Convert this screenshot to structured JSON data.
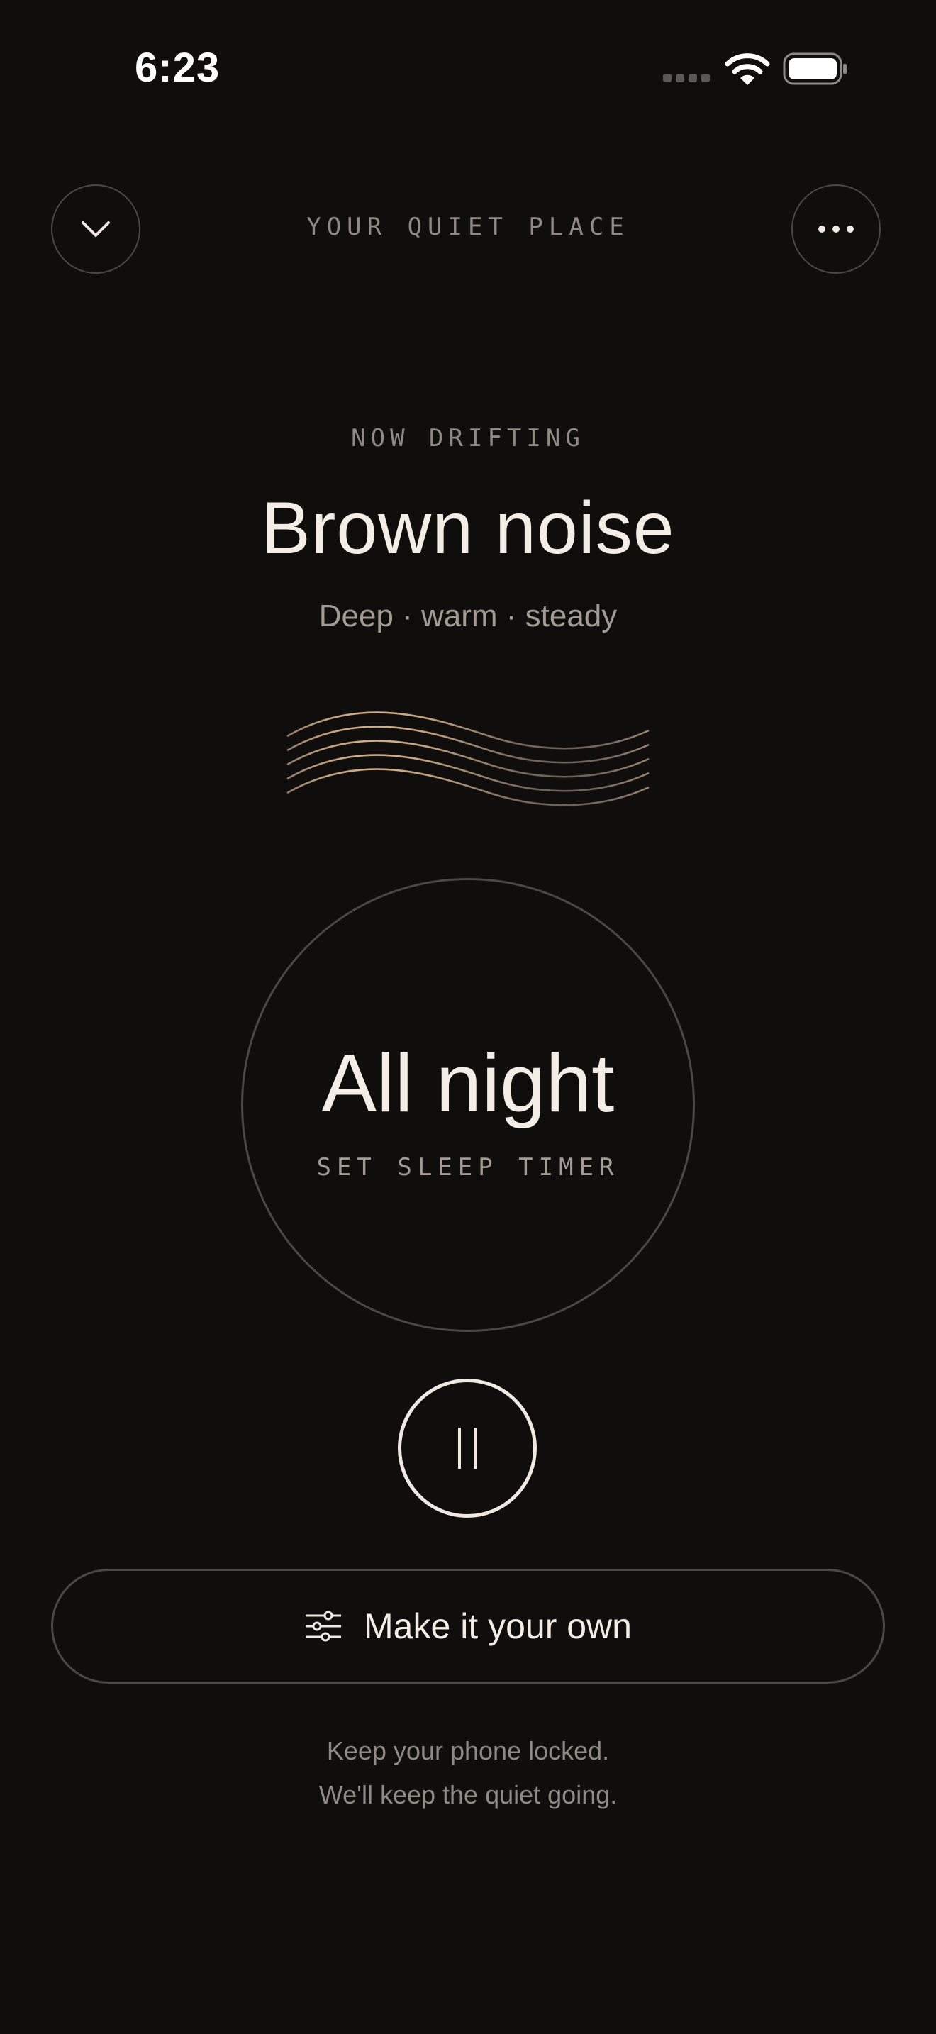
{
  "status_bar": {
    "time": "6:23",
    "signal_icon": "signal-bars-icon",
    "wifi_icon": "wifi-icon",
    "battery_icon": "battery-icon"
  },
  "header": {
    "title": "YOUR QUIET PLACE",
    "collapse_icon": "chevron-down-icon",
    "more_icon": "more-horizontal-icon"
  },
  "now_playing": {
    "eyebrow": "NOW DRIFTING",
    "title": "Brown noise",
    "subtitle": "Deep · warm · steady",
    "waveform_icon": "sound-wave-icon",
    "wave_color": "#c9a584"
  },
  "timer": {
    "value": "All night",
    "label": "SET SLEEP TIMER"
  },
  "playback": {
    "pause_icon": "pause-icon"
  },
  "customize": {
    "label": "Make it your own",
    "icon": "sliders-icon"
  },
  "footer": {
    "line1": "Keep your phone locked.",
    "line2": "We'll keep the quiet going."
  },
  "colors": {
    "background": "#0f0e0d",
    "text": "#efe9e1",
    "muted": "#8f8a83",
    "accent": "#c9a584"
  }
}
